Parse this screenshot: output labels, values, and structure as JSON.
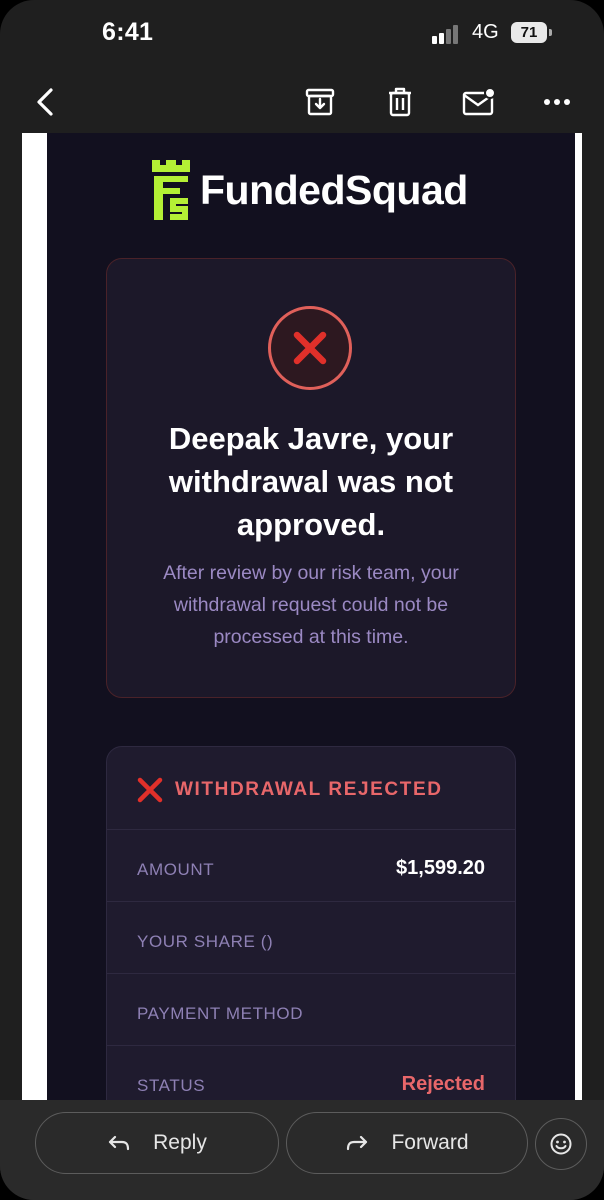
{
  "status_bar": {
    "time": "6:41",
    "network": "4G",
    "battery": "71"
  },
  "toolbar": {
    "back_icon": "chevron-left-icon",
    "archive_icon": "archive-icon",
    "delete_icon": "trash-icon",
    "unread_icon": "mail-unread-icon",
    "more_icon": "more-icon"
  },
  "email": {
    "brand": "FundedSquad",
    "brand_color": "#b4f035",
    "headline": "Deepak Javre, your withdrawal was not approved.",
    "subtext": "After review by our risk team, your withdrawal request could not be processed at this time.",
    "details": {
      "title": "WITHDRAWAL REJECTED",
      "rows": [
        {
          "label": "AMOUNT",
          "value": "$1,599.20"
        },
        {
          "label": "YOUR SHARE ()",
          "value": ""
        },
        {
          "label": "PAYMENT METHOD",
          "value": ""
        },
        {
          "label": "STATUS",
          "value": "Rejected"
        }
      ]
    },
    "accent_red": "#e8676a"
  },
  "actions": {
    "reply": "Reply",
    "forward": "Forward",
    "emoji_icon": "smiley-icon"
  }
}
